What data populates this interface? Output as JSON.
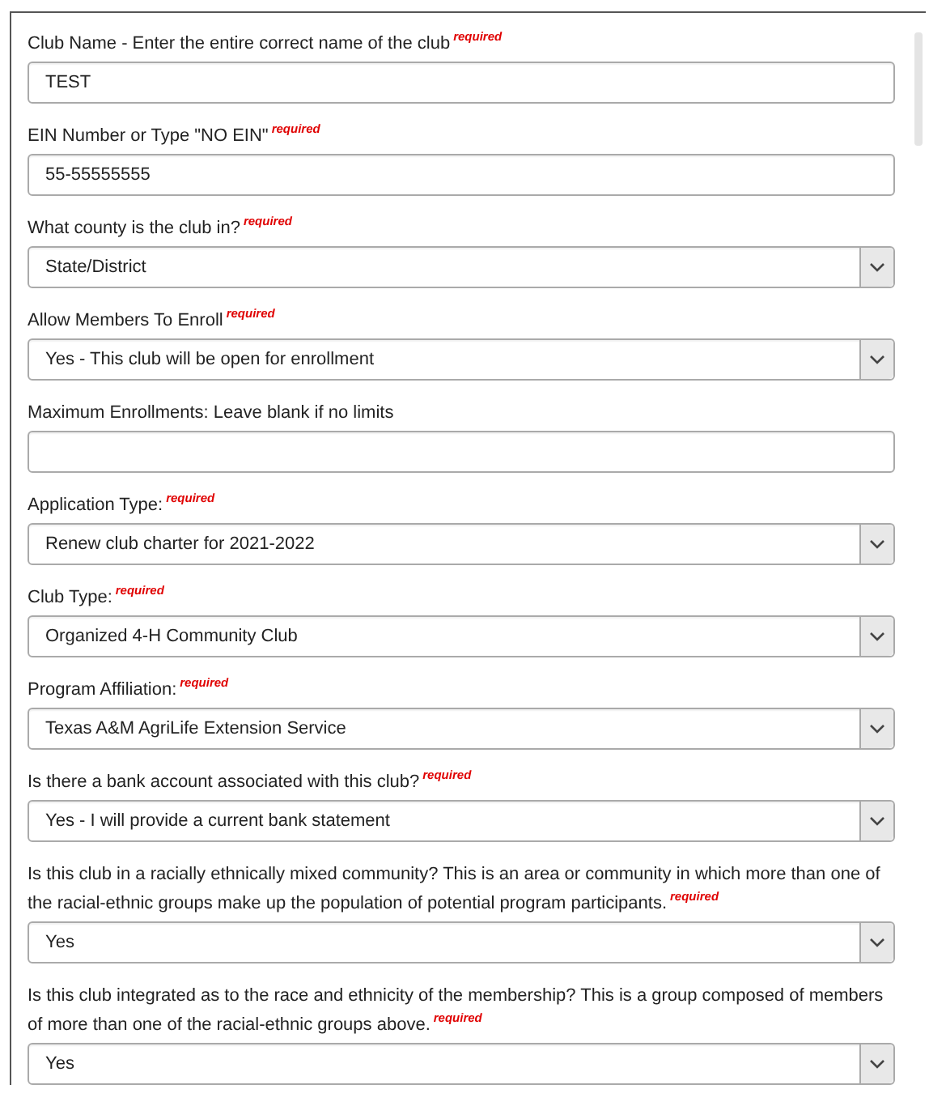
{
  "fields": [
    {
      "kind": "text",
      "label": "Club Name - Enter the entire correct name of the club",
      "required": "required",
      "value": "TEST"
    },
    {
      "kind": "text",
      "label": "EIN Number or Type \"NO EIN\"",
      "required": "required",
      "value": "55-55555555"
    },
    {
      "kind": "select",
      "label": "What county is the club in?",
      "required": "required",
      "value": "State/District"
    },
    {
      "kind": "select",
      "label": "Allow Members To Enroll",
      "required": "required",
      "value": "Yes - This club will be open for enrollment"
    },
    {
      "kind": "text",
      "label": "Maximum Enrollments: Leave blank if no limits"
    },
    {
      "kind": "select",
      "label": "Application Type:",
      "required": "required",
      "value": "Renew club charter for 2021-2022"
    },
    {
      "kind": "select",
      "label": "Club Type:",
      "required": "required",
      "value": "Organized 4-H Community Club"
    },
    {
      "kind": "select",
      "label": "Program Affiliation:",
      "required": "required",
      "value": "Texas A&M AgriLife Extension Service"
    },
    {
      "kind": "select",
      "label": "Is there a bank account associated with this club?",
      "required": "required",
      "value": "Yes - I will provide a current bank statement"
    },
    {
      "kind": "select",
      "label": "Is this club in a racially ethnically mixed community? This is an area or community in which more than one of the racial-ethnic groups make up the population of potential program participants.",
      "required": "required",
      "value": "Yes"
    },
    {
      "kind": "select",
      "label": "Is this club integrated as to the race and ethnicity of the membership? This is a group composed of members of more than one of the racial-ethnic groups above.",
      "required": "required",
      "value": "Yes"
    }
  ]
}
